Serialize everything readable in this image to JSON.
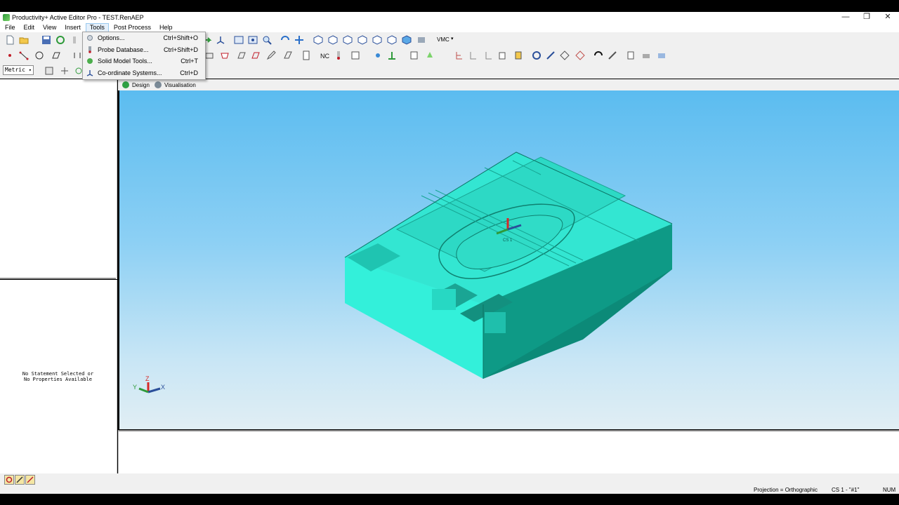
{
  "window": {
    "title": "Productivity+ Active Editor Pro - TEST.RenAEP",
    "minimize": "—",
    "restore": "❐",
    "close": "✕"
  },
  "menu": [
    {
      "label": "File"
    },
    {
      "label": "Edit"
    },
    {
      "label": "View"
    },
    {
      "label": "Insert"
    },
    {
      "label": "Tools"
    },
    {
      "label": "Post Process"
    },
    {
      "label": "Help"
    }
  ],
  "tools_menu": [
    {
      "label": "Options...",
      "shortcut": "Ctrl+Shift+O",
      "icon": "options-icon"
    },
    {
      "label": "Probe Database...",
      "shortcut": "Ctrl+Shift+D",
      "icon": "probe-icon"
    },
    {
      "label": "Solid Model Tools...",
      "shortcut": "Ctrl+T",
      "icon": "solid-model-icon"
    },
    {
      "label": "Co-ordinate Systems...",
      "shortcut": "Ctrl+D",
      "icon": "coordinate-icon"
    }
  ],
  "toolbar": {
    "machine_label": "VMC",
    "units_value": "Metric"
  },
  "tabs": [
    {
      "label": "Design",
      "color": "#2ea043"
    },
    {
      "label": "Visualisation",
      "color": "#7b8a97"
    }
  ],
  "left_panel": {
    "no_props_line1": "No Statement Selected or",
    "no_props_line2": "No Properties Available"
  },
  "triad": {
    "x": "X",
    "y": "Y",
    "z": "Z"
  },
  "part": {
    "cs_label": "CS 1",
    "face_color": "#34e6d2"
  },
  "status": {
    "projection": "Projection = Orthographic",
    "cs": "CS 1 - \"#1\"",
    "num": "NUM"
  }
}
